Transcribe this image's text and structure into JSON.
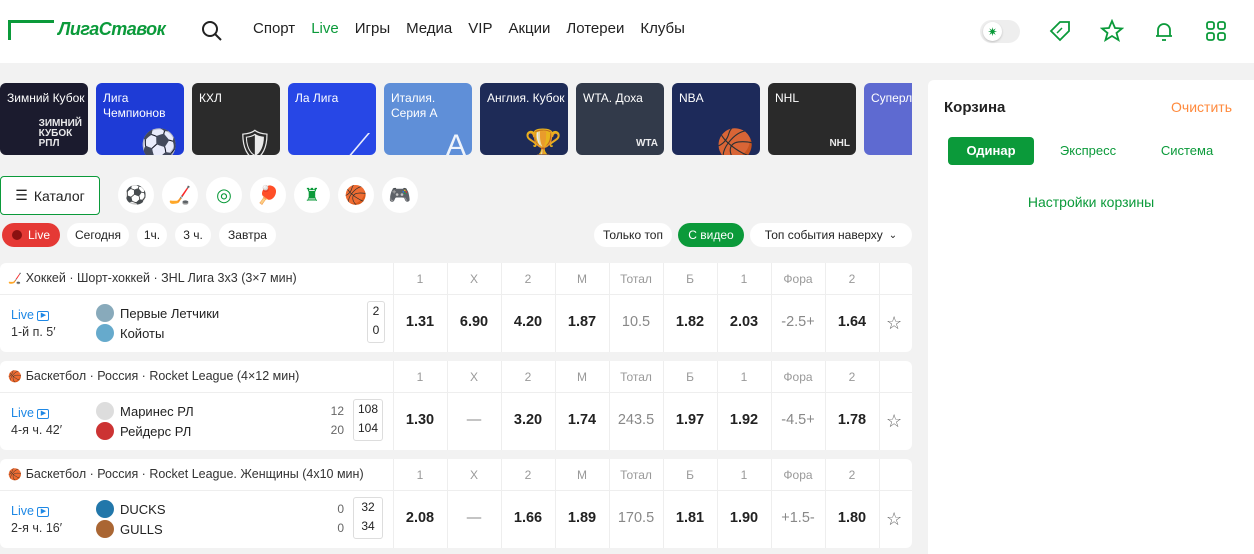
{
  "brand": {
    "logo_text": "ЛигаСтавок",
    "accent": "#0b9a3a"
  },
  "nav": [
    "Спорт",
    "Live",
    "Игры",
    "Медиа",
    "VIP",
    "Акции",
    "Лотереи",
    "Клубы"
  ],
  "nav_active": "Live",
  "tiles": [
    {
      "label": "Зимний Кубок",
      "icon": "ЗИМНИЙ\nКУБОК\nРПЛ",
      "bg": "#1b1b2e"
    },
    {
      "label": "Лига Чемпионов",
      "icon": "⚽",
      "bg": "#1e3bd6"
    },
    {
      "label": "КХЛ",
      "icon": "🛡",
      "bg": "#2b2b2b"
    },
    {
      "label": "Ла Лига",
      "icon": "⟋",
      "bg": "#2747e6"
    },
    {
      "label": "Италия. Серия А",
      "icon": "A",
      "bg": "#5f8fd8"
    },
    {
      "label": "Англия. Кубок",
      "icon": "🏆",
      "bg": "#1e2b57"
    },
    {
      "label": "WTA. Доха",
      "icon": "WTA",
      "bg": "#323a4a"
    },
    {
      "label": "NBA",
      "icon": "🏀",
      "bg": "#1d2a5a"
    },
    {
      "label": "NHL",
      "icon": "NHL",
      "bg": "#2a2a2a"
    },
    {
      "label": "Суперл Женщ",
      "icon": "●",
      "bg": "#5e6ad1"
    }
  ],
  "catalog_label": "Каталог",
  "sport_icons": [
    "football-icon",
    "hockey-icon",
    "tennis-icon",
    "table-tennis-icon",
    "esports-icon",
    "basketball-icon",
    "gamepad-icon"
  ],
  "chips": {
    "live": "Live",
    "today": "Сегодня",
    "h1": "1ч.",
    "h3": "3 ч.",
    "tomorrow": "Завтра",
    "only_top": "Только топ",
    "with_video": "С видео",
    "top_events": "Топ события наверху"
  },
  "columns": [
    "1",
    "X",
    "2",
    "М",
    "Тотал",
    "Б",
    "1",
    "Фора",
    "2"
  ],
  "events": [
    {
      "league": "Хоккей · Шорт-хоккей · ЗHL Лига 3х3 (3×7 мин)",
      "live": "Live",
      "period": "1-й п. 5′",
      "team1": "Первые Летчики",
      "team2": "Койоты",
      "sub1": "",
      "sub2": "",
      "score1": "2",
      "score2": "0",
      "odds": [
        "1.31",
        "6.90",
        "4.20",
        "1.87",
        "10.5",
        "1.82",
        "2.03",
        "-2.5+",
        "1.64"
      ]
    },
    {
      "league": "Баскетбол · Россия · Rocket League (4×12 мин)",
      "live": "Live",
      "period": "4-я ч. 42′",
      "team1": "Маринес РЛ",
      "team2": "Рейдерс РЛ",
      "sub1": "12",
      "sub2": "20",
      "score1": "108",
      "score2": "104",
      "odds": [
        "1.30",
        "—",
        "3.20",
        "1.74",
        "243.5",
        "1.97",
        "1.92",
        "-4.5+",
        "1.78"
      ]
    },
    {
      "league": "Баскетбол · Россия · Rocket League. Женщины (4х10 мин)",
      "live": "Live",
      "period": "2-я ч. 16′",
      "team1": "DUCKS",
      "team2": "GULLS",
      "sub1": "0",
      "sub2": "0",
      "score1": "32",
      "score2": "34",
      "odds": [
        "2.08",
        "—",
        "1.66",
        "1.89",
        "170.5",
        "1.81",
        "1.90",
        "+1.5-",
        "1.80"
      ]
    }
  ],
  "basket": {
    "title": "Корзина",
    "clear": "Очистить",
    "tabs": [
      "Одинар",
      "Экспресс",
      "Система"
    ],
    "active_tab": "Одинар",
    "settings": "Настройки корзины"
  }
}
